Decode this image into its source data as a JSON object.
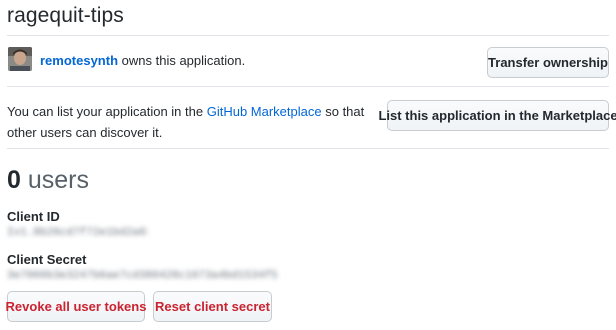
{
  "app": {
    "title": "ragequit-tips"
  },
  "owner": {
    "username": "remotesynth",
    "text": " owns this application.",
    "transfer_label": "Transfer ownership"
  },
  "marketplace": {
    "text_before": "You can list your application in the ",
    "link_text": "GitHub Marketplace",
    "text_after": " so that other users can discover it.",
    "button_label": "List this application in the Marketplace"
  },
  "users": {
    "count": "0",
    "label": " users"
  },
  "client_id": {
    "label": "Client ID",
    "value": "Iv1.8b26cd7f72e1bd2a6b3"
  },
  "client_secret": {
    "label": "Client Secret",
    "value": "3e7066b3e3247b6ae7cd380428c1673a4bd1534f5"
  },
  "actions": {
    "revoke_label": "Revoke all user tokens",
    "reset_label": "Reset client secret"
  },
  "colors": {
    "link": "#0366d6",
    "danger": "#cb2431",
    "border": "#e1e4e8"
  }
}
